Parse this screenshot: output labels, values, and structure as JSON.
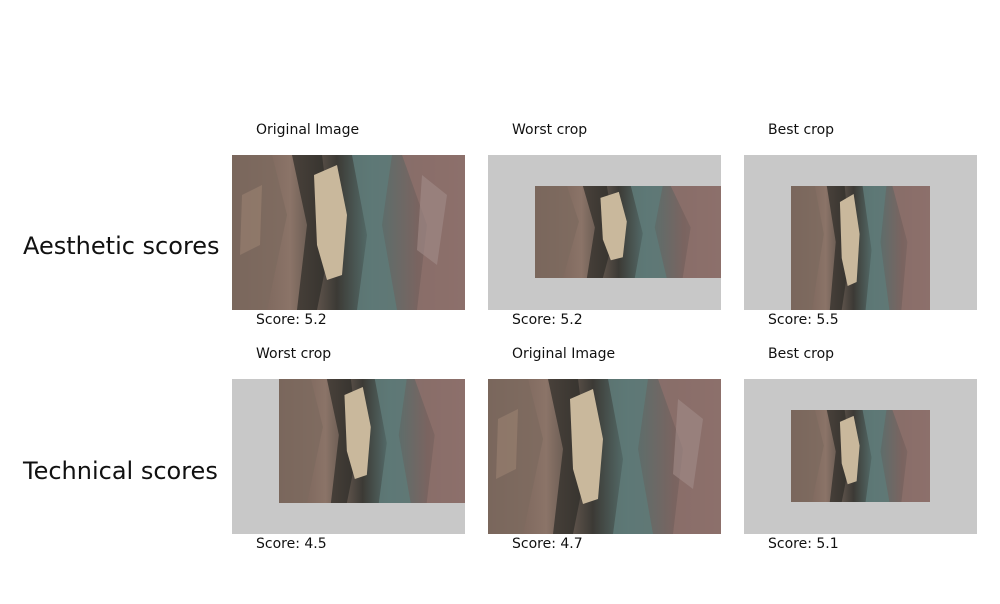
{
  "rows": [
    {
      "label": "Aesthetic scores",
      "cells": [
        {
          "caption": "Original Image",
          "score": "Score: 5.2"
        },
        {
          "caption": "Worst crop",
          "score": "Score: 5.2"
        },
        {
          "caption": "Best crop",
          "score": "Score: 5.5"
        }
      ]
    },
    {
      "label": "Technical scores",
      "cells": [
        {
          "caption": "Worst crop",
          "score": "Score: 4.5"
        },
        {
          "caption": "Original Image",
          "score": "Score: 4.7"
        },
        {
          "caption": "Best crop",
          "score": "Score: 5.1"
        }
      ]
    }
  ],
  "colors": {
    "panel_background": "#c8c8c8"
  }
}
